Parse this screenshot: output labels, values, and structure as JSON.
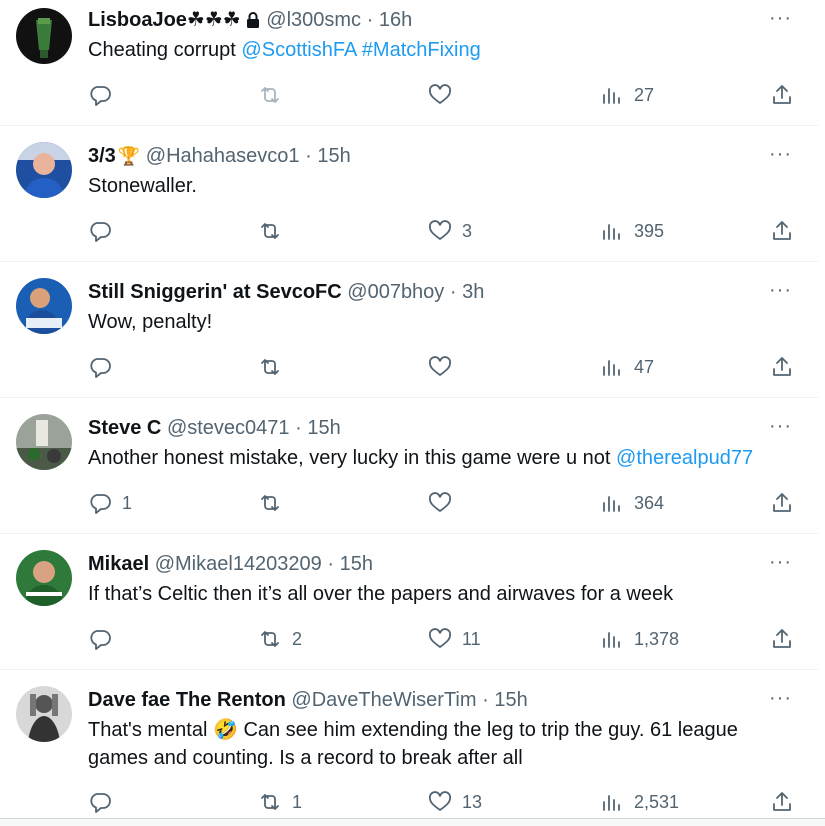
{
  "tweets": [
    {
      "name": "LisboaJoe☘☘☘",
      "badge": "",
      "handle": "@l300smc",
      "time": "16h",
      "locked": true,
      "text_plain": "Cheating corrupt ",
      "mentions": [
        "@ScottishFA",
        "#MatchFixing"
      ],
      "replies": "",
      "retweets": "",
      "likes": "",
      "views": "27"
    },
    {
      "name": "3/3",
      "badge": "🏆",
      "handle": "@Hahahasevco1",
      "time": "15h",
      "text_plain": "Stonewaller.",
      "replies": "",
      "retweets": "",
      "likes": "3",
      "views": "395"
    },
    {
      "name": "Still Sniggerin' at SevcoFC",
      "badge": "",
      "handle": "@007bhoy",
      "time": "3h",
      "text_plain": "Wow, penalty!",
      "replies": "",
      "retweets": "",
      "likes": "",
      "views": "47"
    },
    {
      "name": "Steve C",
      "badge": "",
      "handle": "@stevec0471",
      "time": "15h",
      "text_plain": "Another honest mistake,  very lucky in this game were u not ",
      "mentions": [
        "@therealpud77"
      ],
      "replies": "1",
      "retweets": "",
      "likes": "",
      "views": "364"
    },
    {
      "name": "Mikael",
      "badge": "",
      "handle": "@Mikael14203209",
      "time": "15h",
      "text_plain": "If that’s Celtic then it’s all over the papers and airwaves for a week",
      "replies": "",
      "retweets": "2",
      "likes": "11",
      "views": "1,378"
    },
    {
      "name": "Dave fae The Renton",
      "badge": "",
      "handle": "@DaveTheWiserTim",
      "time": "15h",
      "text_plain": "That's mental 🤣 Can see him extending the leg to trip the guy. 61 league games and counting. Is a record to break after all",
      "replies": "",
      "retweets": "1",
      "likes": "13",
      "views": "2,531"
    }
  ],
  "ui": {
    "dot": "·",
    "more": "···"
  },
  "icons": [
    "reply-icon",
    "retweet-icon",
    "like-icon",
    "views-icon",
    "share-icon",
    "lock-icon",
    "more-icon"
  ],
  "colors": {
    "text": "#0f1419",
    "muted": "#536471",
    "link": "#1d9bf0",
    "divider": "#eff3f4"
  }
}
